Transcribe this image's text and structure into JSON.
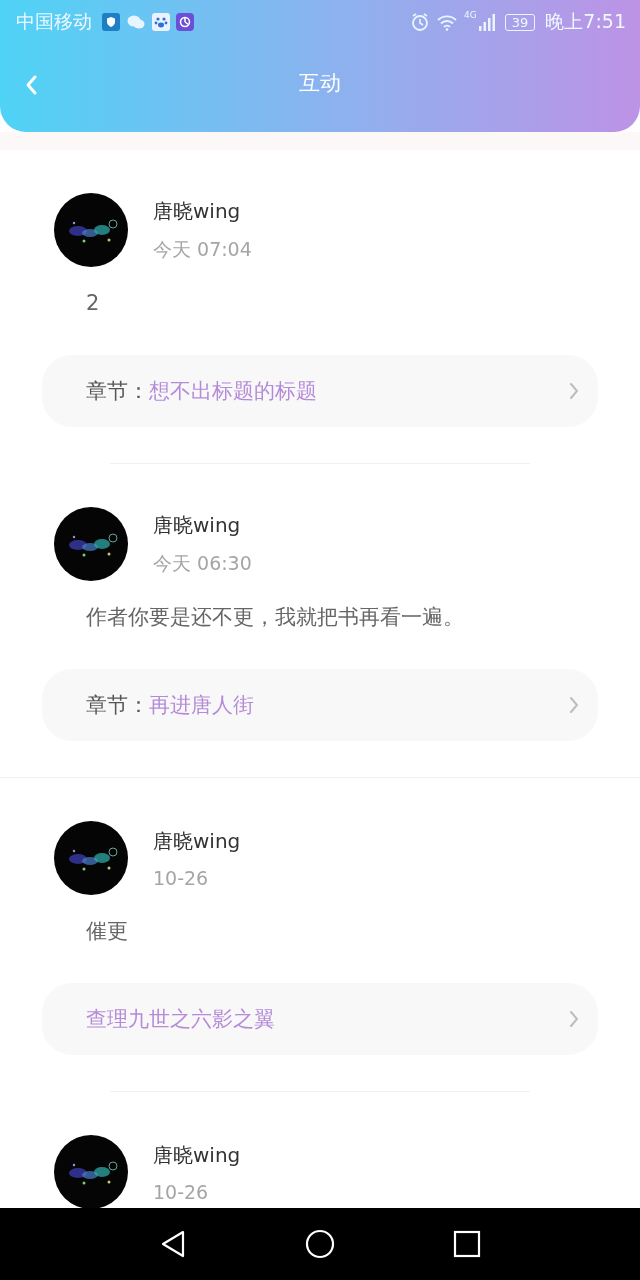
{
  "status_bar": {
    "carrier": "中国移动",
    "network": "4G",
    "battery": "39",
    "time": "晚上7:51"
  },
  "header": {
    "title": "互动"
  },
  "comments": [
    {
      "user": "唐晓wing",
      "time": "今天 07:04",
      "content": "2",
      "chapter": {
        "label": "章节：",
        "title": "想不出标题的标题"
      }
    },
    {
      "user": "唐晓wing",
      "time": "今天 06:30",
      "content": "作者你要是还不更，我就把书再看一遍。",
      "chapter": {
        "label": "章节：",
        "title": "再进唐人街"
      }
    },
    {
      "user": "唐晓wing",
      "time": "10-26",
      "content": "催更",
      "chapter": {
        "title": "查理九世之六影之翼"
      }
    },
    {
      "user": "唐晓wing",
      "time": "10-26"
    }
  ]
}
